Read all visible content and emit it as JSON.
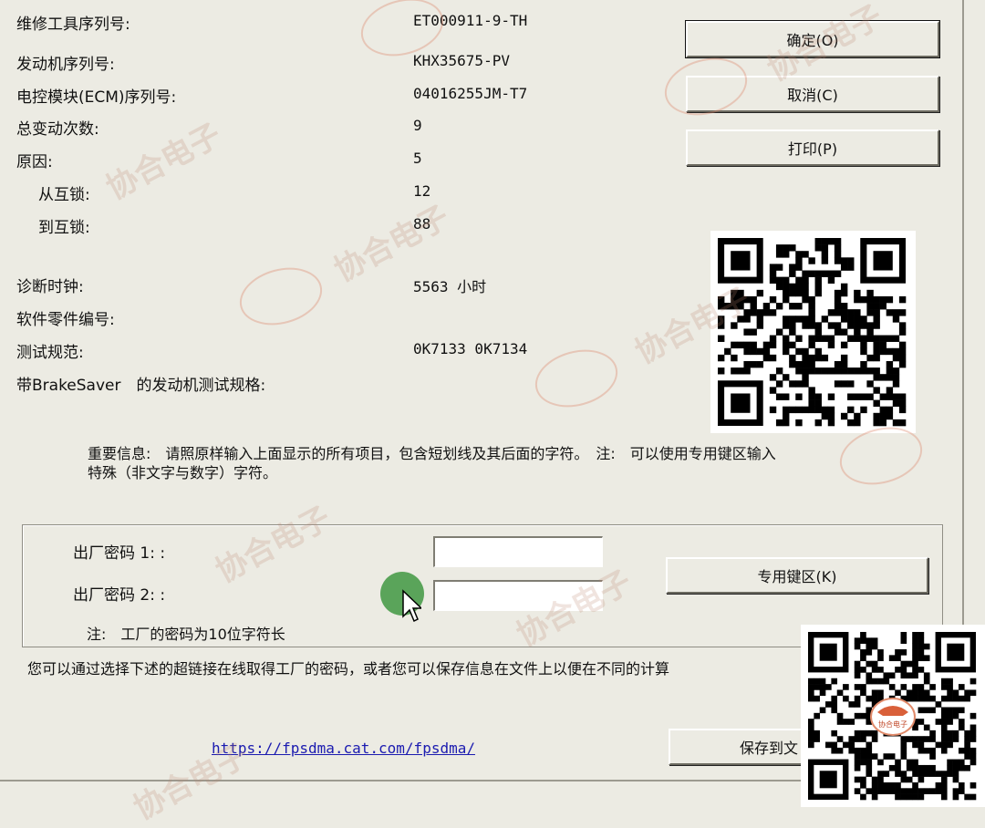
{
  "fields": [
    {
      "label": "维修工具序列号:",
      "value": "ET000911-9-TH"
    },
    {
      "label": "发动机序列号:",
      "value": "KHX35675-PV"
    },
    {
      "label": "电控模块(ECM)序列号:",
      "value": "04016255JM-T7"
    },
    {
      "label": "总变动次数:",
      "value": "9"
    },
    {
      "label": "原因:",
      "value": "5"
    },
    {
      "label": "从互锁:",
      "value": "12"
    },
    {
      "label": "到互锁:",
      "value": "88"
    },
    {
      "label": "诊断时钟:",
      "value": "5563 小时"
    },
    {
      "label": "软件零件编号:",
      "value": ""
    },
    {
      "label": "测试规范:",
      "value": "0K7133 0K7134"
    },
    {
      "label": "带BrakeSaver　的发动机测试规格:",
      "value": ""
    }
  ],
  "buttons": {
    "ok": "确定(O)",
    "cancel": "取消(C)",
    "print": "打印(P)",
    "keypad": "专用键区(K)",
    "save": "保存到文"
  },
  "notice": {
    "line1": "重要信息:　请照原样输入上面显示的所有项目，包含短划线及其后面的字符。　注:　可以使用专用键区输入",
    "line2": "特殊（非文字与数字）字符。"
  },
  "passwords": {
    "label1": "出厂密码 1: :",
    "label2": "出厂密码 2: :",
    "note": "注:　工厂的密码为10位字符长",
    "value1": "",
    "value2": ""
  },
  "footer_text": "您可以通过选择下述的超链接在线取得工厂的密码，或者您可以保存信息在文件上以便在不同的计算",
  "link": "https://fpsdma.cat.com/fpsdma/",
  "watermark_text": "协合电子",
  "logo_text": "协合电子",
  "colors": {
    "dialog_bg": "#ecebe3",
    "link": "#1b1bb0",
    "cursor_highlight": "#5aa45a"
  }
}
